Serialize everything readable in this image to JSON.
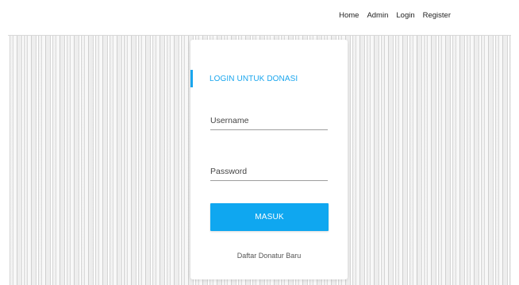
{
  "nav": {
    "items": [
      {
        "label": "Home"
      },
      {
        "label": "Admin"
      },
      {
        "label": "Login"
      },
      {
        "label": "Register"
      }
    ]
  },
  "login": {
    "title": "LOGIN UNTUK DONASI",
    "username_placeholder": "Username",
    "password_placeholder": "Password",
    "submit_label": "MASUK",
    "register_link": "Daftar Donatur Baru",
    "accent_color": "#1aa6ee",
    "button_color": "#0fa7f0"
  }
}
